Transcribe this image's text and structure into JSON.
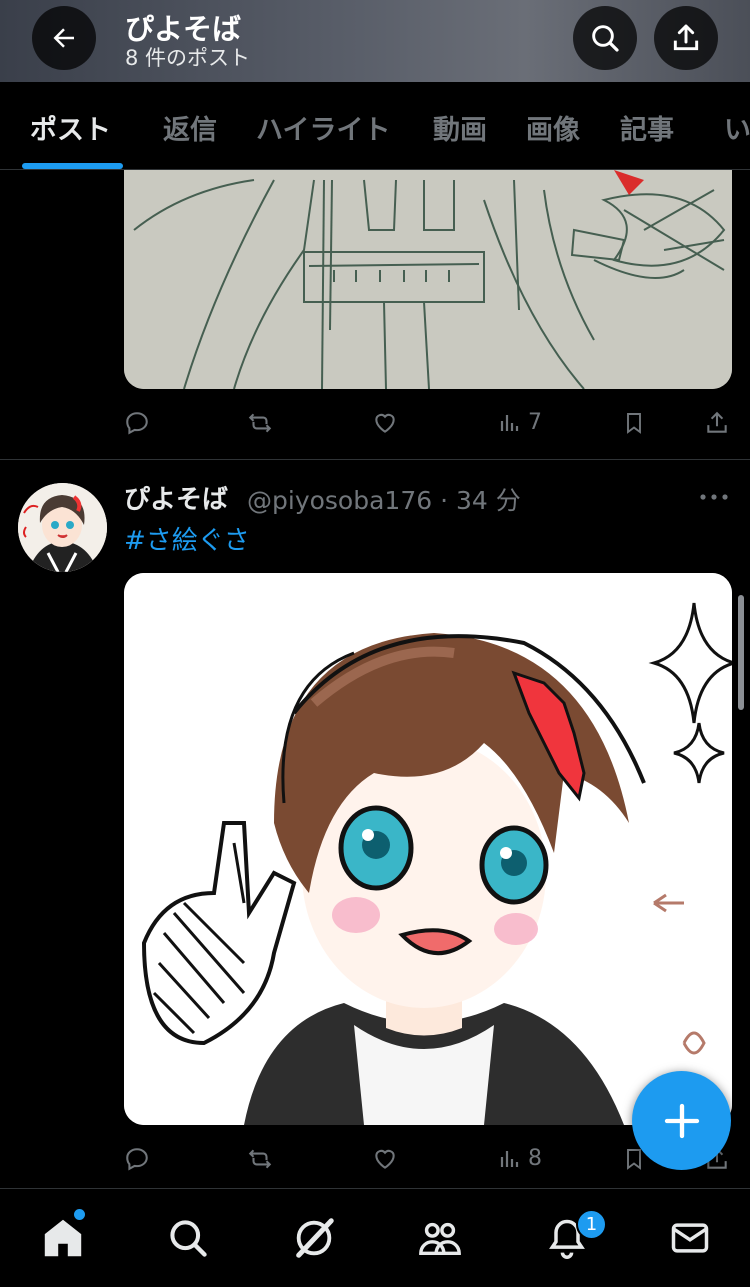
{
  "header": {
    "title": "ぴよそば",
    "subtitle": "8 件のポスト"
  },
  "tabs": [
    {
      "label": "ポスト",
      "active": true
    },
    {
      "label": "返信"
    },
    {
      "label": "ハイライト"
    },
    {
      "label": "動画"
    },
    {
      "label": "画像"
    },
    {
      "label": "記事"
    },
    {
      "label": "い"
    }
  ],
  "post1": {
    "views": "7"
  },
  "post2": {
    "display_name": "ぴよそば",
    "handle_time": "@piyosoba176 · 34 分",
    "hashtag": "#さ絵ぐさ",
    "views": "8"
  },
  "bottom_nav": {
    "notifications_badge": "1"
  },
  "colors": {
    "accent": "#1d9bf0",
    "muted": "#71767b",
    "text": "#e7e9ea",
    "background": "#000000"
  }
}
